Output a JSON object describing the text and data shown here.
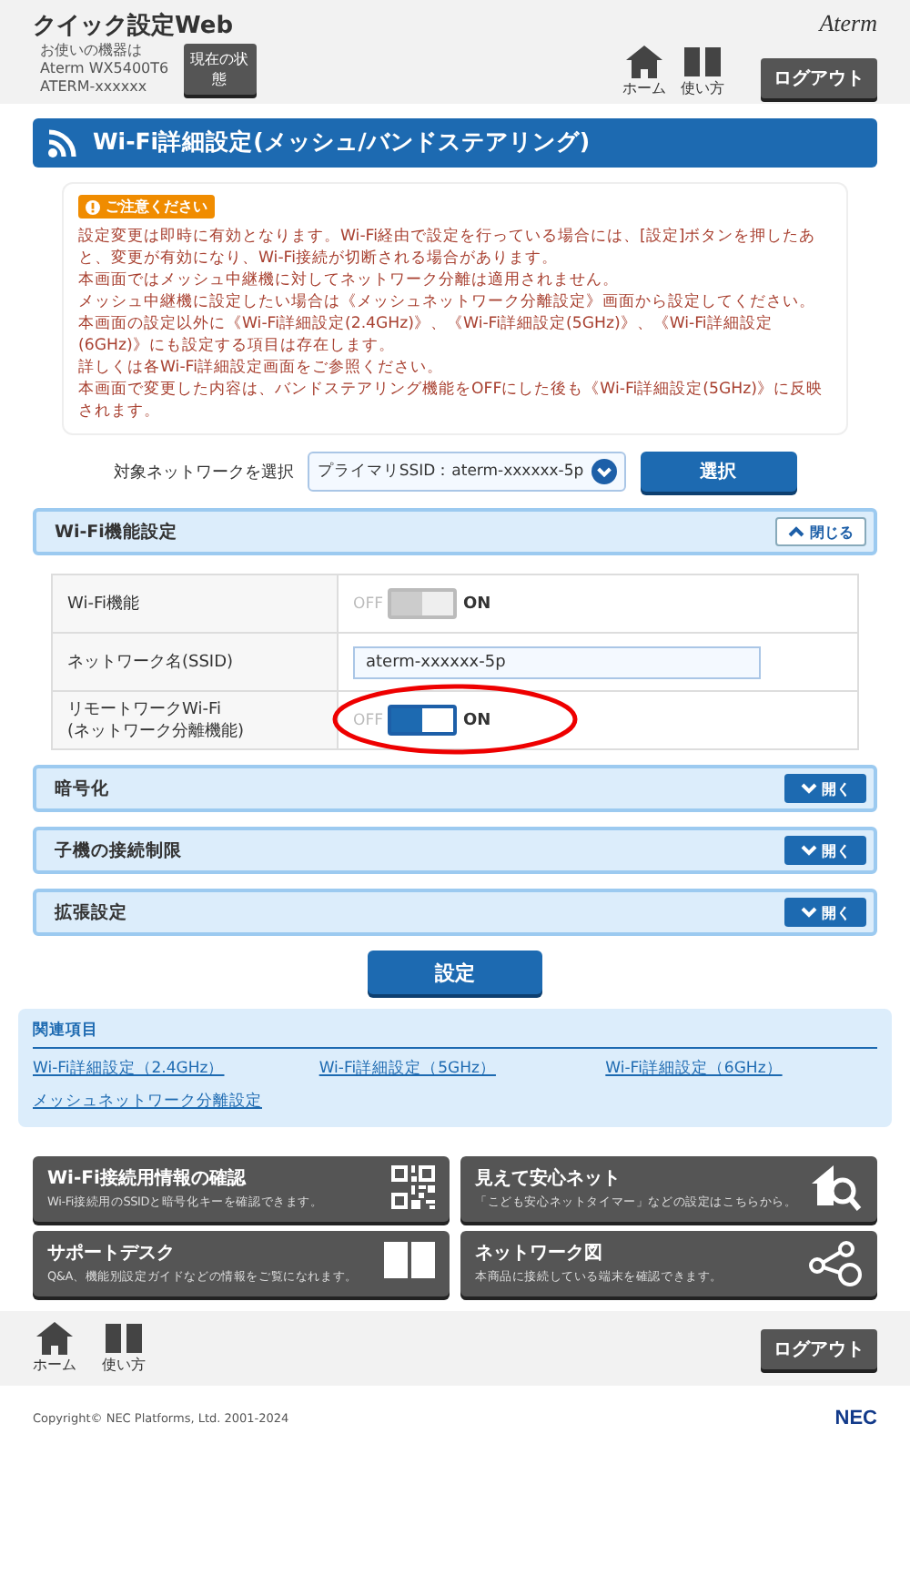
{
  "header": {
    "title": "クイック設定Web",
    "device_lines": [
      "お使いの機器は",
      "Aterm WX5400T6",
      "ATERM-xxxxxx"
    ],
    "status_button": "現在の状態",
    "brand": "Aterm",
    "nav": [
      {
        "label": "ホーム",
        "kind": "home"
      },
      {
        "label": "使い方",
        "kind": "book"
      }
    ],
    "logout": "ログアウト"
  },
  "page_title": "Wi-Fi詳細設定(メッシュ/バンドステアリング)",
  "notice": {
    "badge": "ご注意ください",
    "lines": [
      "設定変更は即時に有効となります。Wi-Fi経由で設定を行っている場合には、[設定]ボタンを押したあと、変更が有効になり、Wi-Fi接続が切断される場合があります。",
      "本画面ではメッシュ中継機に対してネットワーク分離は適用されません。",
      "メッシュ中継機に設定したい場合は《メッシュネットワーク分離設定》画面から設定してください。",
      "本画面の設定以外に《Wi-Fi詳細設定(2.4GHz)》、《Wi-Fi詳細設定(5GHz)》、《Wi-Fi詳細設定(6GHz)》にも設定する項目は存在します。",
      "詳しくは各Wi-Fi詳細設定画面をご参照ください。",
      "本画面で変更した内容は、バンドステアリング機能をOFFにした後も《Wi-Fi詳細設定(5GHz)》に反映されます。"
    ]
  },
  "network_select": {
    "label": "対象ネットワークを選択",
    "value": "プライマリSSID：aterm-xxxxxx-5p",
    "button": "選択"
  },
  "sections": [
    {
      "title": "Wi-Fi機能設定",
      "expanded": true,
      "toggle_label": "閉じる",
      "rows": [
        {
          "kind": "toggle",
          "label": "Wi-Fi機能",
          "off_text": "OFF",
          "on_text": "ON",
          "on": true,
          "disabled": true,
          "highlighted": false
        },
        {
          "kind": "input",
          "label": "ネットワーク名(SSID)",
          "value": "aterm-xxxxxx-5p"
        },
        {
          "kind": "toggle",
          "label": "リモートワークWi-Fi\n(ネットワーク分離機能)",
          "off_text": "OFF",
          "on_text": "ON",
          "on": true,
          "disabled": false,
          "highlighted": true
        }
      ]
    },
    {
      "title": "暗号化",
      "expanded": false,
      "toggle_label": "開く"
    },
    {
      "title": "子機の接続制限",
      "expanded": false,
      "toggle_label": "開く"
    },
    {
      "title": "拡張設定",
      "expanded": false,
      "toggle_label": "開く"
    }
  ],
  "submit": "設定",
  "related": {
    "title": "関連項目",
    "links": [
      "Wi-Fi詳細設定（2.4GHz）",
      "Wi-Fi詳細設定（5GHz）",
      "Wi-Fi詳細設定（6GHz）",
      "メッシュネットワーク分離設定"
    ]
  },
  "tiles": [
    {
      "title": "Wi-Fi接続用情報の確認",
      "desc": "Wi-Fi接続用のSSIDと暗号化キーを確認できます。",
      "kind": "qr"
    },
    {
      "title": "見えて安心ネット",
      "desc": "「こども安心ネットタイマー」などの設定はこちらから。",
      "kind": "house"
    },
    {
      "title": "サポートデスク",
      "desc": "Q&A、機能別設定ガイドなどの情報をご覧になれます。",
      "kind": "book"
    },
    {
      "title": "ネットワーク図",
      "desc": "本商品に接続している端末を確認できます。",
      "kind": "network"
    }
  ],
  "footer": {
    "nav": [
      {
        "label": "ホーム",
        "kind": "home"
      },
      {
        "label": "使い方",
        "kind": "book"
      }
    ],
    "logout": "ログアウト",
    "copyright": "Copyright© NEC Platforms, Ltd. 2001-2024",
    "logo": "NEC"
  }
}
